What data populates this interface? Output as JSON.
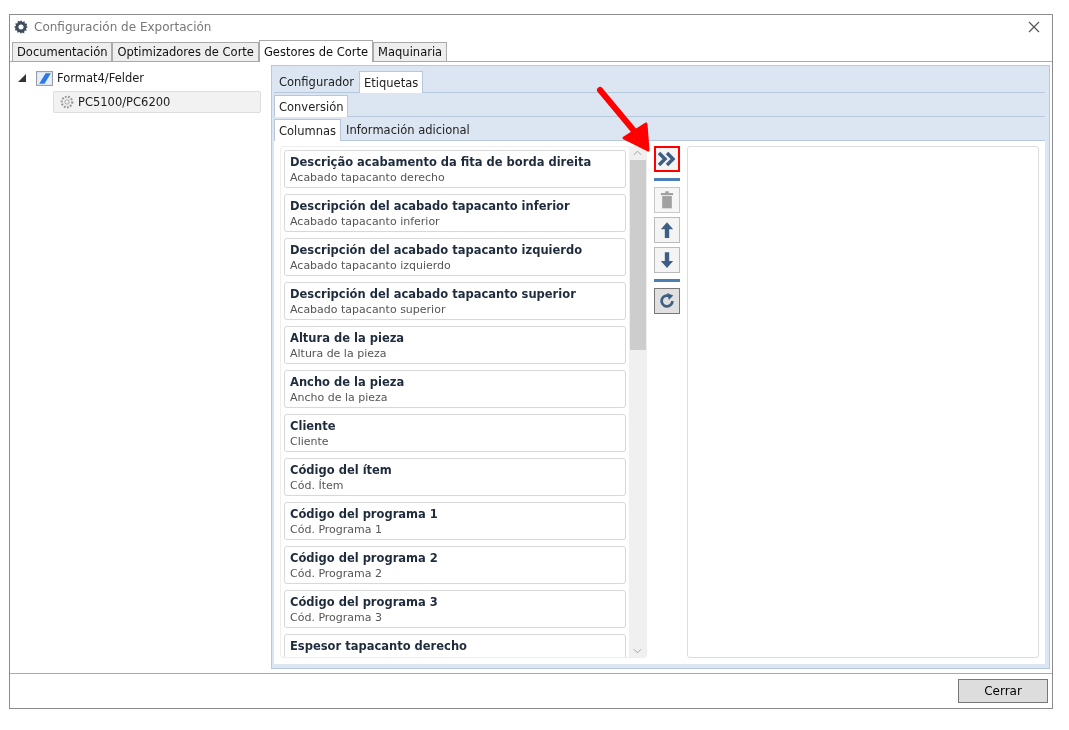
{
  "window": {
    "title": "Configuración de Exportación"
  },
  "tabs": [
    {
      "label": "Documentación",
      "selected": false
    },
    {
      "label": "Optimizadores de Corte",
      "selected": false
    },
    {
      "label": "Gestores de Corte",
      "selected": true
    },
    {
      "label": "Maquinaria",
      "selected": false
    }
  ],
  "tree": [
    {
      "label": "Format4/Felder",
      "expanded": true,
      "selected": false,
      "children": [
        {
          "label": "PC5100/PC6200",
          "selected": true
        }
      ]
    }
  ],
  "inner_tabs": [
    {
      "label": "Configurador",
      "selected": false
    },
    {
      "label": "Etiquetas",
      "selected": true
    }
  ],
  "sub_tabs": [
    {
      "label": "Conversión",
      "selected": true
    }
  ],
  "column_tabs": [
    {
      "label": "Columnas",
      "selected": true
    },
    {
      "label": "Información adicional",
      "selected": false
    }
  ],
  "columns": [
    {
      "title": "Descrição acabamento da fita de borda direita",
      "subtitle": "Acabado tapacanto derecho"
    },
    {
      "title": "Descripción del acabado tapacanto inferior",
      "subtitle": "Acabado tapacanto inferior"
    },
    {
      "title": "Descripción del acabado tapacanto izquierdo",
      "subtitle": "Acabado tapacanto izquierdo"
    },
    {
      "title": "Descripción del acabado tapacanto superior",
      "subtitle": "Acabado tapacanto superior"
    },
    {
      "title": "Altura de la pieza",
      "subtitle": "Altura de la pieza"
    },
    {
      "title": "Ancho de la pieza",
      "subtitle": "Ancho de la pieza"
    },
    {
      "title": "Cliente",
      "subtitle": "Cliente"
    },
    {
      "title": "Código del ítem",
      "subtitle": "Cód. Ítem"
    },
    {
      "title": "Código del programa 1",
      "subtitle": "Cód. Programa 1"
    },
    {
      "title": "Código del programa 2",
      "subtitle": "Cód. Programa 2"
    },
    {
      "title": "Código del programa 3",
      "subtitle": "Cód. Programa 3"
    },
    {
      "title": "Espesor tapacanto derecho"
    }
  ],
  "actions": [
    {
      "kind": "add",
      "disabled": false,
      "highlighted": true
    },
    {
      "kind": "separator"
    },
    {
      "kind": "delete",
      "disabled": true,
      "highlighted": false
    },
    {
      "kind": "up",
      "disabled": false,
      "highlighted": false
    },
    {
      "kind": "down",
      "disabled": false,
      "highlighted": false
    },
    {
      "kind": "separator"
    },
    {
      "kind": "reset",
      "disabled": false,
      "highlighted": false
    }
  ],
  "buttons": [
    {
      "label": "Cerrar"
    }
  ]
}
